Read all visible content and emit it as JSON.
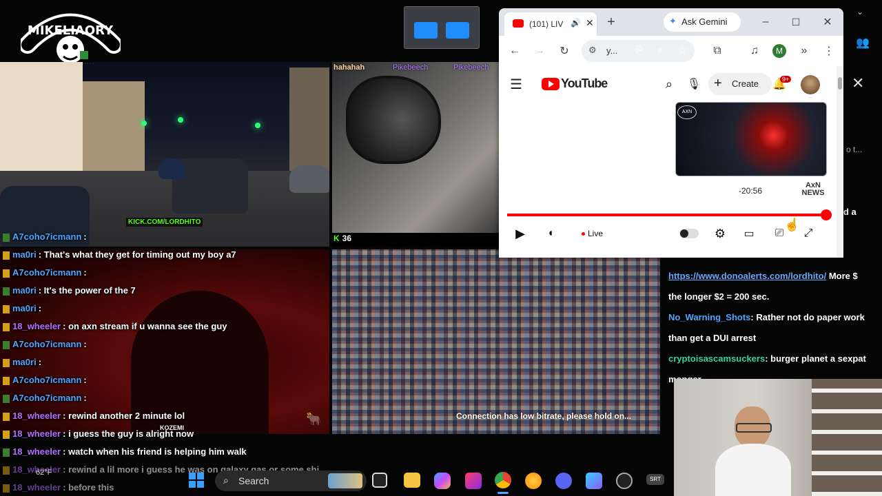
{
  "logo": {
    "text": "MIKELIAORY"
  },
  "tiles": {
    "tile1": {
      "watermark": "KICK.COM/LORDHITO"
    },
    "tile2": {
      "overlay_text": "hahahah",
      "badge_count": "36",
      "user_tag1": "Pikebeech",
      "user_tag2": "Pikebeech"
    },
    "tile4": {
      "status": "Connection has low bitrate, please hold on..."
    },
    "tile3": {
      "watermark": "KOZEMI"
    }
  },
  "chat_overlay": [
    {
      "user": "A7coho7icmann",
      "msg": "",
      "color": "#4ea6ff",
      "faded": false
    },
    {
      "user": "ma0ri",
      "msg": "That's what they get for timing out my boy a7",
      "color": "#4ea6ff",
      "faded": false
    },
    {
      "user": "A7coho7icmann",
      "msg": "",
      "color": "#4ea6ff",
      "faded": false
    },
    {
      "user": "ma0ri",
      "msg": "It's the power of the 7",
      "color": "#4ea6ff",
      "faded": false
    },
    {
      "user": "ma0ri",
      "msg": "",
      "color": "#4ea6ff",
      "faded": false
    },
    {
      "user": "18_wheeler",
      "msg": "on axn stream if u wanna see the guy",
      "color": "#b070ff",
      "faded": false
    },
    {
      "user": "A7coho7icmann",
      "msg": "",
      "color": "#4ea6ff",
      "faded": false
    },
    {
      "user": "ma0ri",
      "msg": "",
      "color": "#4ea6ff",
      "faded": false
    },
    {
      "user": "A7coho7icmann",
      "msg": "",
      "color": "#4ea6ff",
      "faded": false
    },
    {
      "user": "A7coho7icmann",
      "msg": "",
      "color": "#4ea6ff",
      "faded": false
    },
    {
      "user": "18_wheeler",
      "msg": "rewind another 2 minute lol",
      "color": "#b070ff",
      "faded": false
    },
    {
      "user": "18_wheeler",
      "msg": "i guess the guy is alright now",
      "color": "#b070ff",
      "faded": false
    },
    {
      "user": "18_wheeler",
      "msg": "watch when his friend is helping him walk",
      "color": "#b070ff",
      "faded": false
    },
    {
      "user": "18_wheeler",
      "msg": "rewind a lil more i guess he was on galaxy gas or some shi",
      "color": "#b070ff",
      "faded": true
    },
    {
      "user": "18_wheeler",
      "msg": "before this",
      "color": "#b070ff",
      "faded": true
    }
  ],
  "right_chat": {
    "link": "https://www.donoalerts.com/lordhito/",
    "link_tail": "More $",
    "line2": "the longer $2 = 200 sec.",
    "msg1_user": "No_Warning_Shots",
    "msg1_text": "Rather not do paper work than get a DUI arrest",
    "msg2_user": "cryptoisascamsuckers",
    "msg2_text": "burger planet a sexpat monger",
    "side_text1": "d a",
    "side_text2": "o t..."
  },
  "browser": {
    "tab_title": "(101) LIV",
    "gemini_label": "Ask Gemini",
    "address_text": "y...",
    "profile_initial": "M"
  },
  "youtube": {
    "logo_text": "YouTube",
    "create_label": "Create",
    "notif_badge": "9+",
    "time_remaining": "-20:56",
    "news_logo": "AxN NEWS",
    "live_label": "Live",
    "progress_fraction": 0.99
  },
  "taskbar": {
    "search_placeholder": "Search",
    "temp": "62°F"
  },
  "colors": {
    "youtube_red": "#ff0000",
    "chat_blue": "#4ea6ff",
    "chat_purple": "#b070ff",
    "kick_green": "#53fc18"
  }
}
